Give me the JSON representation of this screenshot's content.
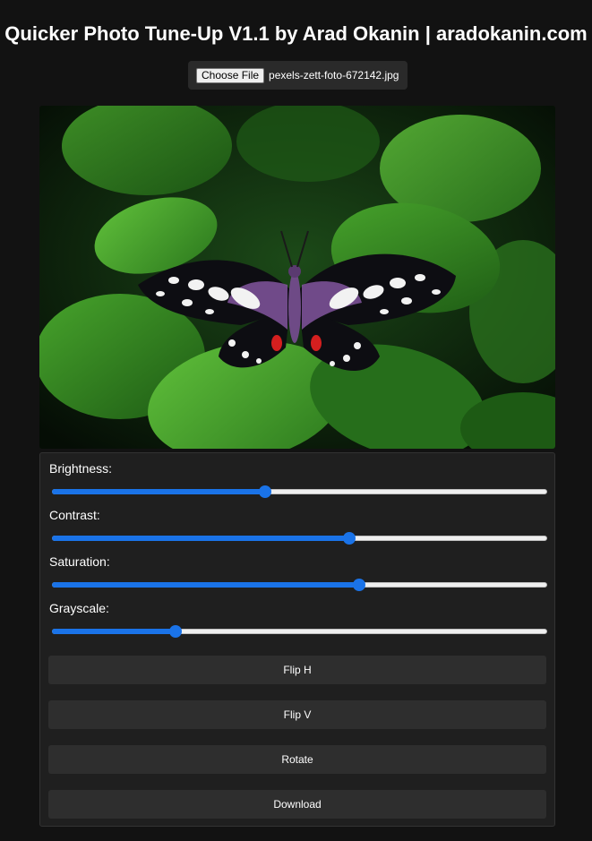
{
  "title": "Quicker Photo Tune-Up V1.1 by Arad Okanin | aradokanin.com",
  "file_input": {
    "button_label": "Choose File",
    "file_name": "pexels-zett-foto-672142.jpg"
  },
  "image": {
    "subject": "butterfly-on-green-leaves"
  },
  "sliders": [
    {
      "label": "Brightness:",
      "value": 0.43
    },
    {
      "label": "Contrast:",
      "value": 0.6
    },
    {
      "label": "Saturation:",
      "value": 0.62
    },
    {
      "label": "Grayscale:",
      "value": 0.25
    }
  ],
  "buttons": {
    "flip_h": "Flip H",
    "flip_v": "Flip V",
    "rotate": "Rotate",
    "download": "Download"
  },
  "colors": {
    "background": "#121212",
    "accent": "#1a73e8",
    "button_bg": "#2e2e2e"
  }
}
